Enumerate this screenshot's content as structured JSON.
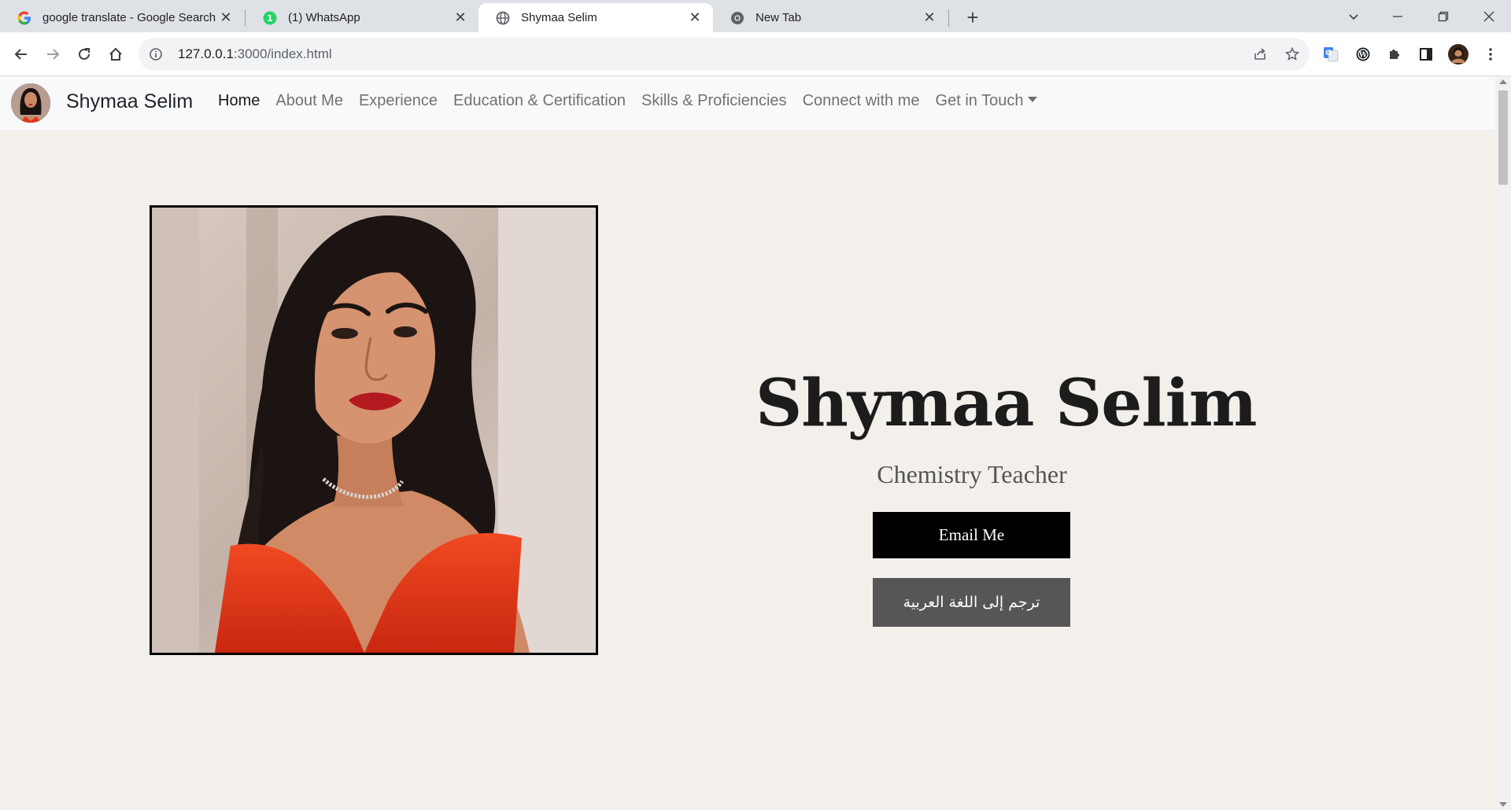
{
  "browser": {
    "tabs": [
      {
        "title": "google translate - Google Search",
        "icon": "google-g-icon",
        "active": false
      },
      {
        "title": "(1) WhatsApp",
        "icon": "whatsapp-icon",
        "active": false
      },
      {
        "title": "Shymaa Selim",
        "icon": "globe-icon",
        "active": true
      },
      {
        "title": "New Tab",
        "icon": "chrome-icon",
        "active": false
      }
    ],
    "url_host": "127.0.0.1",
    "url_rest": ":3000/index.html"
  },
  "nav": {
    "brand": "Shymaa Selim",
    "links": [
      "Home",
      "About Me",
      "Experience",
      "Education & Certification",
      "Skills & Proficiencies",
      "Connect with me"
    ],
    "dropdown": "Get in Touch"
  },
  "hero": {
    "name": "Shymaa Selim",
    "subtitle": "Chemistry Teacher",
    "email_button": "Email Me",
    "translate_button": "ترجم إلى اللغة العربية"
  },
  "colors": {
    "page_bg": "#f3f0eb",
    "navbar_bg": "#f8f9fa",
    "email_btn_bg": "#000000",
    "translate_btn_bg": "#565656",
    "dress_red": "#e0361b"
  }
}
